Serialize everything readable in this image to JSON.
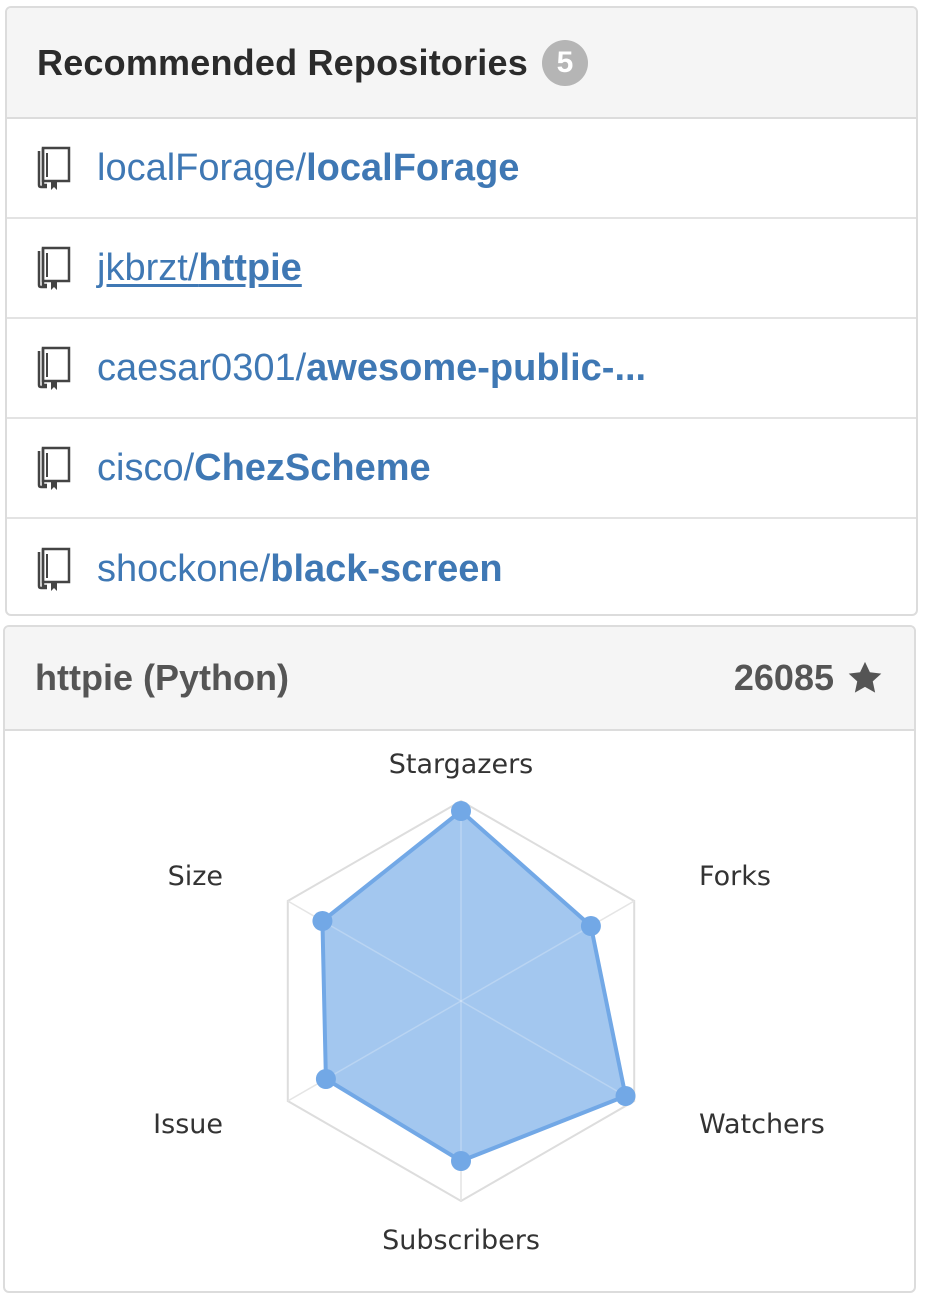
{
  "recommended": {
    "title": "Recommended Repositories",
    "count": "5",
    "items": [
      {
        "owner": "localForage/",
        "name": "localForage",
        "icon": "repo-book-icon"
      },
      {
        "owner": "jkbrzt/",
        "name": "httpie",
        "icon": "repo-book-icon",
        "hovered": true
      },
      {
        "owner": "caesar0301/",
        "name": "awesome-public-...",
        "icon": "repo-book-icon"
      },
      {
        "owner": "cisco/",
        "name": "ChezScheme",
        "icon": "repo-book-icon"
      },
      {
        "owner": "shockone/",
        "name": "black-screen",
        "icon": "repo-book-icon"
      }
    ]
  },
  "detail": {
    "title": "httpie (Python)",
    "stars": "26085",
    "star_icon": "star-icon"
  },
  "chart_data": {
    "type": "radar",
    "axes": [
      "Stargazers",
      "Forks",
      "Watchers",
      "Subscribers",
      "Issue",
      "Size"
    ],
    "values": [
      0.95,
      0.75,
      0.95,
      0.8,
      0.78,
      0.8
    ],
    "range": [
      0,
      1
    ],
    "colors": {
      "fill": "#9ec4ee",
      "stroke": "#72a8e6",
      "point": "#72a8e6",
      "grid": "#dddddd",
      "link": "#3f78b4",
      "badge": "#b5b5b5"
    }
  }
}
